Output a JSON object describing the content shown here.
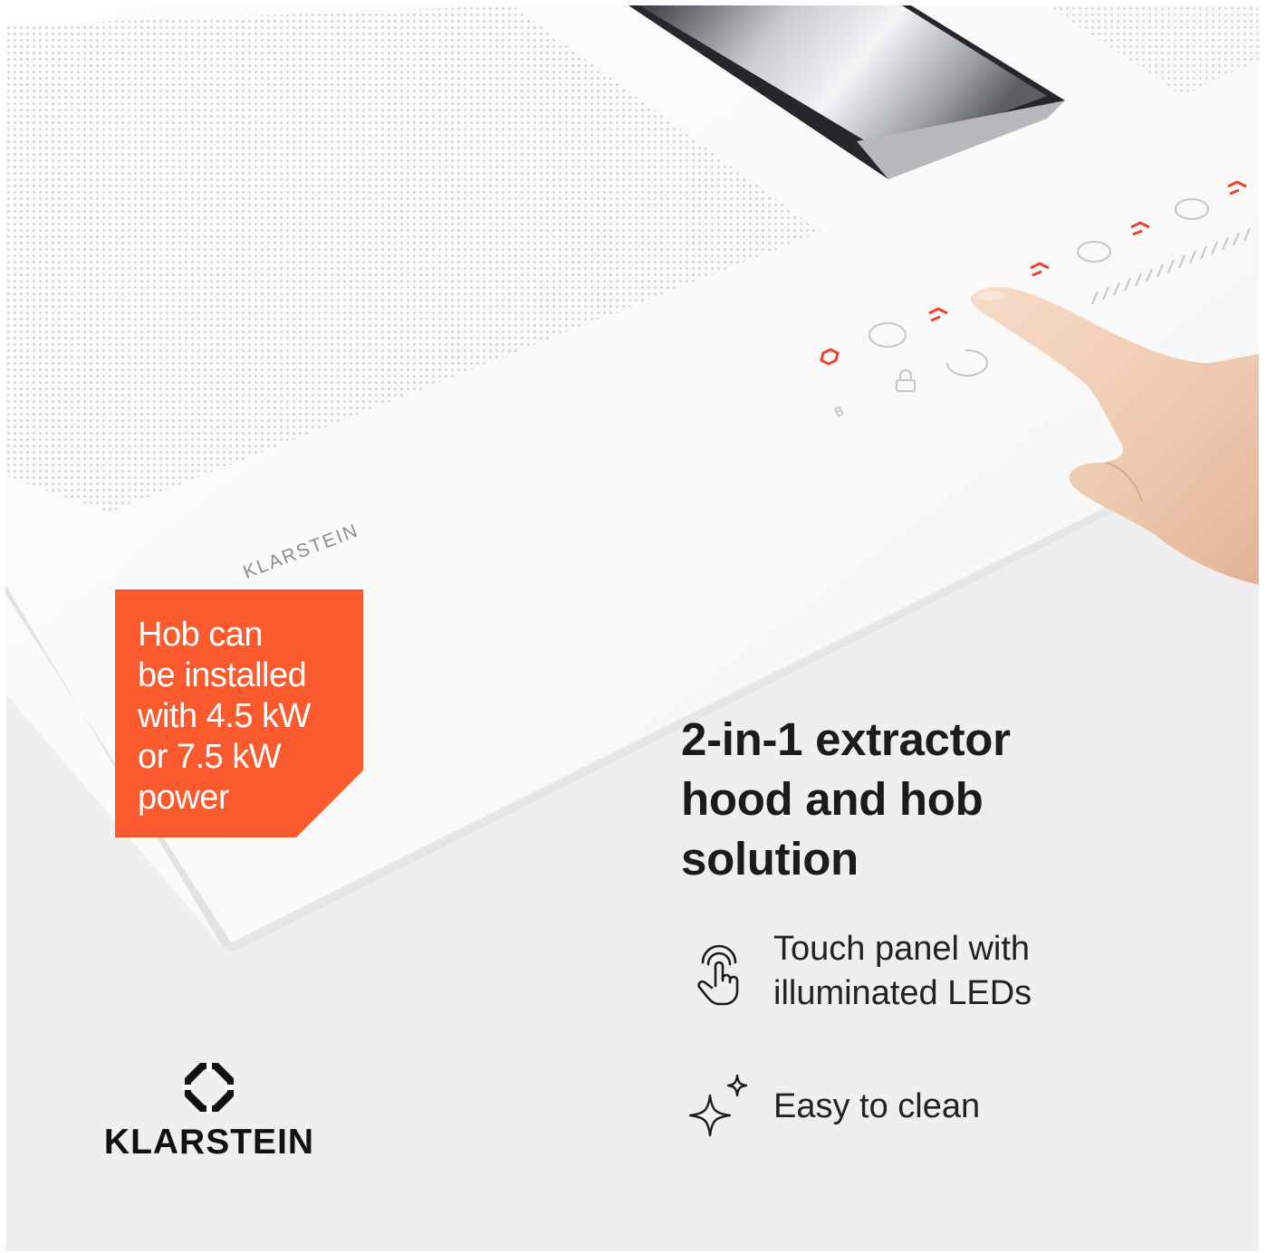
{
  "badge": {
    "text": "Hob can\nbe installed\nwith 4.5 kW\nor 7.5 kW\npower",
    "color": "#fa5a2d"
  },
  "headline": "2-in-1 extractor\nhood and hob\nsolution",
  "features": [
    {
      "icon": "touch-hand-icon",
      "label": "Touch panel with\nilluminated LEDs"
    },
    {
      "icon": "sparkle-icon",
      "label": "Easy to clean"
    }
  ],
  "brand": {
    "name": "KLARSTEIN",
    "icon": "klarstein-logo-icon"
  },
  "hob_print": "KLARSTEIN",
  "led_color": "#e8452f"
}
